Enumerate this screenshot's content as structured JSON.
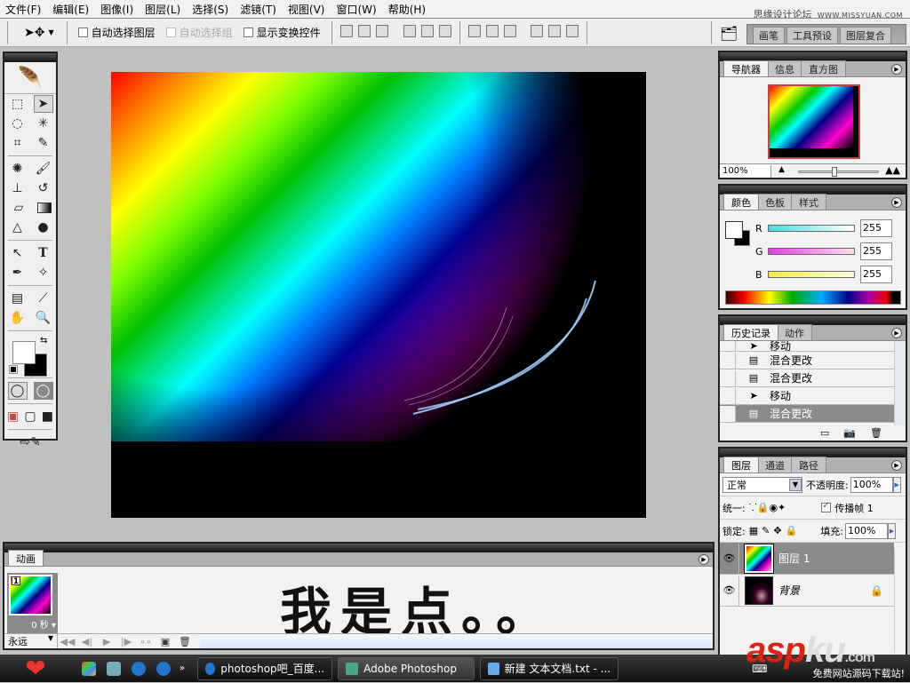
{
  "menubar": {
    "items": [
      "文件(F)",
      "编辑(E)",
      "图像(I)",
      "图层(L)",
      "选择(S)",
      "滤镜(T)",
      "视图(V)",
      "窗口(W)",
      "帮助(H)"
    ],
    "watermark_text": "思缘设计论坛",
    "watermark_url": "WWW.MISSYUAN.COM"
  },
  "options_bar": {
    "tool_icon": "move-tool-icon",
    "auto_select_layer": {
      "label": "自动选择图层",
      "checked": false
    },
    "auto_select_group": {
      "label": "自动选择组",
      "checked": false,
      "disabled": true
    },
    "show_transform_controls": {
      "label": "显示变换控件",
      "checked": false
    },
    "palette_well_tabs": [
      "画笔",
      "工具预设",
      "图层复合"
    ]
  },
  "toolbox": {
    "tools": [
      [
        "rect-marquee",
        "move"
      ],
      [
        "lasso",
        "magic-wand"
      ],
      [
        "crop",
        "slice"
      ],
      [
        "healing-brush",
        "brush"
      ],
      [
        "clone-stamp",
        "history-brush"
      ],
      [
        "eraser",
        "gradient"
      ],
      [
        "blur",
        "dodge"
      ],
      [
        "path-select",
        "type"
      ],
      [
        "pen",
        "custom-shape"
      ],
      [
        "notes",
        "eyedropper"
      ],
      [
        "hand",
        "zoom"
      ]
    ],
    "foreground_color": "#ffffff",
    "background_color": "#000000"
  },
  "navigator": {
    "tabs": [
      "导航器",
      "信息",
      "直方图"
    ],
    "zoom": "100%"
  },
  "color_panel": {
    "tabs": [
      "颜色",
      "色板",
      "样式"
    ],
    "channels": [
      {
        "label": "R",
        "value": "255",
        "color": "#40e0e0"
      },
      {
        "label": "G",
        "value": "255",
        "color": "#e040e0"
      },
      {
        "label": "B",
        "value": "255",
        "color": "#f0f040"
      }
    ]
  },
  "history_panel": {
    "tabs": [
      "历史记录",
      "动作"
    ],
    "items": [
      {
        "label": "移动",
        "icon": "move-tool-icon",
        "selected": false
      },
      {
        "label": "混合更改",
        "icon": "document-icon",
        "selected": false
      },
      {
        "label": "混合更改",
        "icon": "document-icon",
        "selected": false
      },
      {
        "label": "移动",
        "icon": "move-tool-icon",
        "selected": false
      },
      {
        "label": "混合更改",
        "icon": "document-icon",
        "selected": true
      }
    ]
  },
  "layers_panel": {
    "tabs": [
      "图层",
      "通道",
      "路径"
    ],
    "blend_mode": "正常",
    "opacity_label": "不透明度:",
    "opacity": "100%",
    "unify_label": "统一:",
    "propagate_frame_label": "传播帧 1",
    "propagate_frame_checked": true,
    "lock_label": "锁定:",
    "fill_label": "填充:",
    "fill": "100%",
    "layers": [
      {
        "name": "图层 1",
        "visible": true,
        "selected": true,
        "locked": false
      },
      {
        "name": "背景",
        "visible": true,
        "selected": false,
        "locked": true
      }
    ]
  },
  "animation_panel": {
    "tab": "动画",
    "frames": [
      {
        "number": "1",
        "duration": "0 秒"
      }
    ],
    "loop": "永远",
    "overlay_text": "我是点。。"
  },
  "taskbar": {
    "tasks": [
      {
        "label": "photoshop吧_百度...",
        "active": false
      },
      {
        "label": "Adobe Photoshop",
        "active": true
      },
      {
        "label": "新建 文本文档.txt - ...",
        "active": false
      }
    ],
    "watermark_brand": "asp",
    "watermark_brand2": "ku",
    "watermark_com": ".com",
    "watermark_sub": "免费网站源码下载站!"
  }
}
